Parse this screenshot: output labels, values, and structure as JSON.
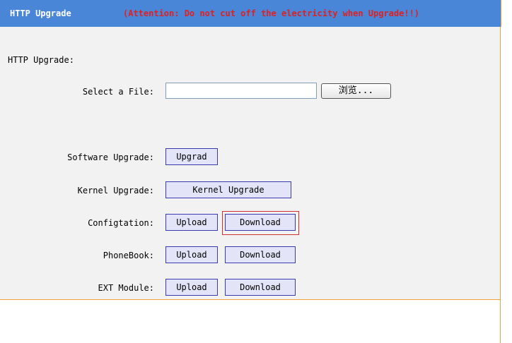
{
  "header": {
    "title": "HTTP Upgrade",
    "warning": "(Attention: Do not cut off the electricity when Upgrade!!)"
  },
  "section": {
    "label": "HTTP Upgrade:"
  },
  "file_select": {
    "label": "Select a File:",
    "value": "",
    "browse_label": "浏览..."
  },
  "software": {
    "label": "Software Upgrade:",
    "button": "Upgrad"
  },
  "kernel": {
    "label": "Kernel Upgrade:",
    "button": "Kernel Upgrade"
  },
  "config": {
    "label": "Configtation:",
    "upload": "Upload",
    "download": "Download"
  },
  "phonebook": {
    "label": "PhoneBook:",
    "upload": "Upload",
    "download": "Download"
  },
  "ext_module": {
    "label": "EXT Module:",
    "upload": "Upload",
    "download": "Download"
  },
  "colors": {
    "header_bg": "#4a86d8",
    "warning": "#e02020",
    "panel_bg": "#f2f2f2",
    "border": "#f0a040",
    "button_bg": "#e4e4f8",
    "highlight": "#d03030"
  }
}
